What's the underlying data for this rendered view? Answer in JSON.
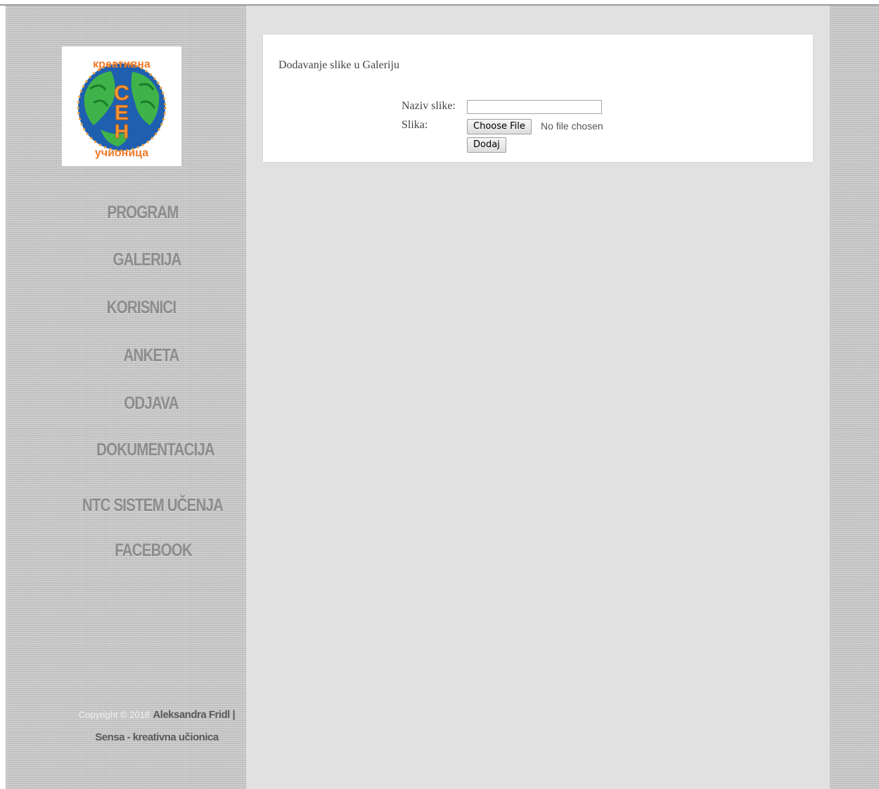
{
  "sidebar": {
    "logo_alt": "Sensa kreativna učionica logo",
    "nav": [
      {
        "label": "PROGRAM"
      },
      {
        "label": "GALERIJA"
      },
      {
        "label": "KORISNICI"
      },
      {
        "label": "ANKETA"
      },
      {
        "label": "ODJAVA"
      },
      {
        "label": "DOKUMENTACIJA"
      },
      {
        "label": "NTC SISTEM UČENJA"
      },
      {
        "label": "FACEBOOK"
      }
    ],
    "footer": {
      "copyright": "Copyright © 2018",
      "author": "Aleksandra Fridl |",
      "site": "Sensa - kreativna učionica"
    }
  },
  "form": {
    "title": "Dodavanje slike u Galeriju",
    "name_label": "Naziv slike:",
    "name_value": "",
    "image_label": "Slika:",
    "choose_file_label": "Choose File",
    "file_status": "No file chosen",
    "submit_label": "Dodaj"
  },
  "colors": {
    "sidebar_bg": "#c9c9c9",
    "main_bg": "#e1e1e1",
    "nav_text": "#8c8c8c"
  }
}
